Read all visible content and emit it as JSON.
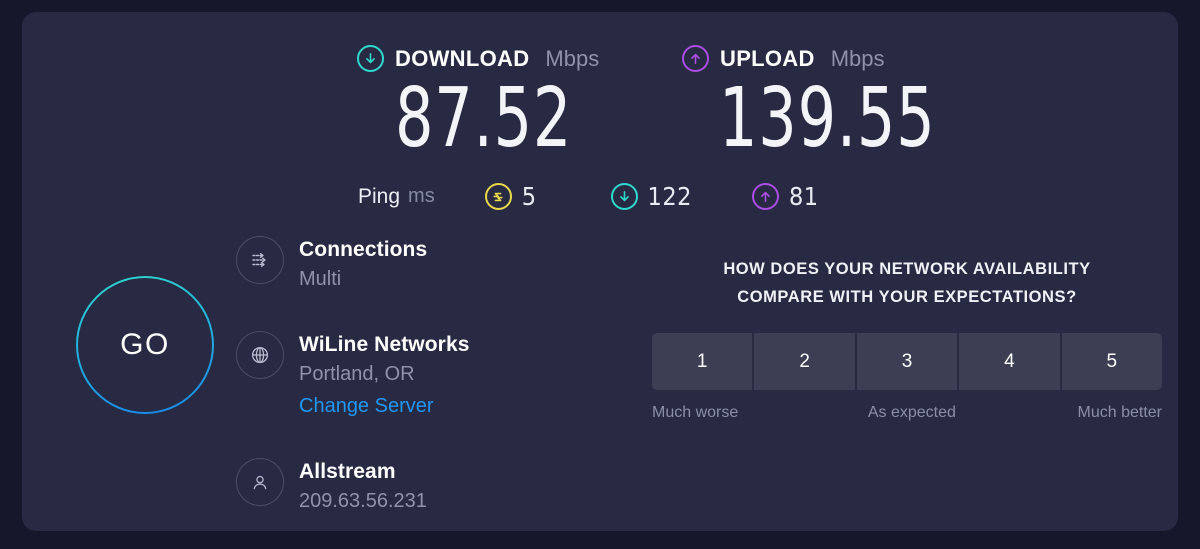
{
  "theme": {
    "page_bg": "#15172a",
    "card_bg": "#272a42",
    "download_color": "#2fd9cd",
    "upload_color": "#ab4ce4",
    "idle_color": "#e8d94b",
    "link_color": "#2196f3"
  },
  "download": {
    "icon": "arrow-down-circle-icon",
    "label": "DOWNLOAD",
    "unit": "Mbps",
    "value": "87.52"
  },
  "upload": {
    "icon": "arrow-up-circle-icon",
    "label": "UPLOAD",
    "unit": "Mbps",
    "value": "139.55"
  },
  "ping": {
    "label": "Ping",
    "unit": "ms",
    "idle": {
      "icon": "idle-latency-icon",
      "value": "5"
    },
    "download_latency": {
      "icon": "arrow-down-circle-icon",
      "value": "122"
    },
    "upload_latency": {
      "icon": "arrow-up-circle-icon",
      "value": "81"
    }
  },
  "go_button": {
    "label": "GO"
  },
  "info": {
    "connections": {
      "icon": "connections-icon",
      "title": "Connections",
      "subtitle": "Multi"
    },
    "server": {
      "icon": "globe-icon",
      "title": "WiLine Networks",
      "subtitle": "Portland, OR",
      "change_link": "Change Server"
    },
    "client": {
      "icon": "person-icon",
      "title": "Allstream",
      "subtitle": "209.63.56.231"
    }
  },
  "survey": {
    "question_line1": "HOW DOES YOUR NETWORK AVAILABILITY",
    "question_line2": "COMPARE WITH YOUR EXPECTATIONS?",
    "options": [
      "1",
      "2",
      "3",
      "4",
      "5"
    ],
    "scale_low": "Much worse",
    "scale_mid": "As expected",
    "scale_high": "Much better"
  }
}
